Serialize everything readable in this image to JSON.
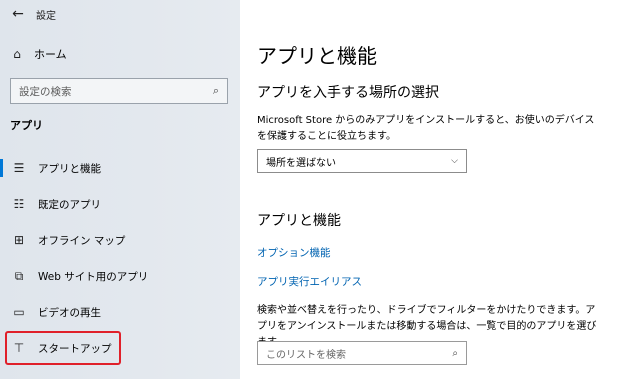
{
  "window": {
    "back_glyph": "←",
    "title": "設定"
  },
  "sidebar": {
    "home": {
      "icon": "⌂",
      "label": "ホーム"
    },
    "search": {
      "placeholder": "設定の検索",
      "icon": "⌕"
    },
    "section_title": "アプリ",
    "items": [
      {
        "icon": "☰",
        "label": "アプリと機能",
        "active": true
      },
      {
        "icon": "☷",
        "label": "既定のアプリ"
      },
      {
        "icon": "⊞",
        "label": "オフライン マップ"
      },
      {
        "icon": "⧉",
        "label": "Web サイト用のアプリ"
      },
      {
        "icon": "▭",
        "label": "ビデオの再生"
      },
      {
        "icon": "⊤",
        "label": "スタートアップ",
        "highlighted": true
      }
    ]
  },
  "main": {
    "title": "アプリと機能",
    "source_heading": "アプリを入手する場所の選択",
    "source_desc": "Microsoft Store からのみアプリをインストールすると、お使いのデバイスを保護することに役立ちます。",
    "source_select": "場所を選ばない",
    "features_heading": "アプリと機能",
    "link_optional": "オプション機能",
    "link_aliases": "アプリ実行エイリアス",
    "list_desc": "検索や並べ替えを行ったり、ドライブでフィルターをかけたりできます。アプリをアンインストールまたは移動する場合は、一覧で目的のアプリを選びます。",
    "list_search_placeholder": "このリストを検索",
    "search_icon": "⌕"
  },
  "colors": {
    "accent": "#0078d7",
    "link": "#0063b1",
    "highlight_box": "#e0202a"
  }
}
